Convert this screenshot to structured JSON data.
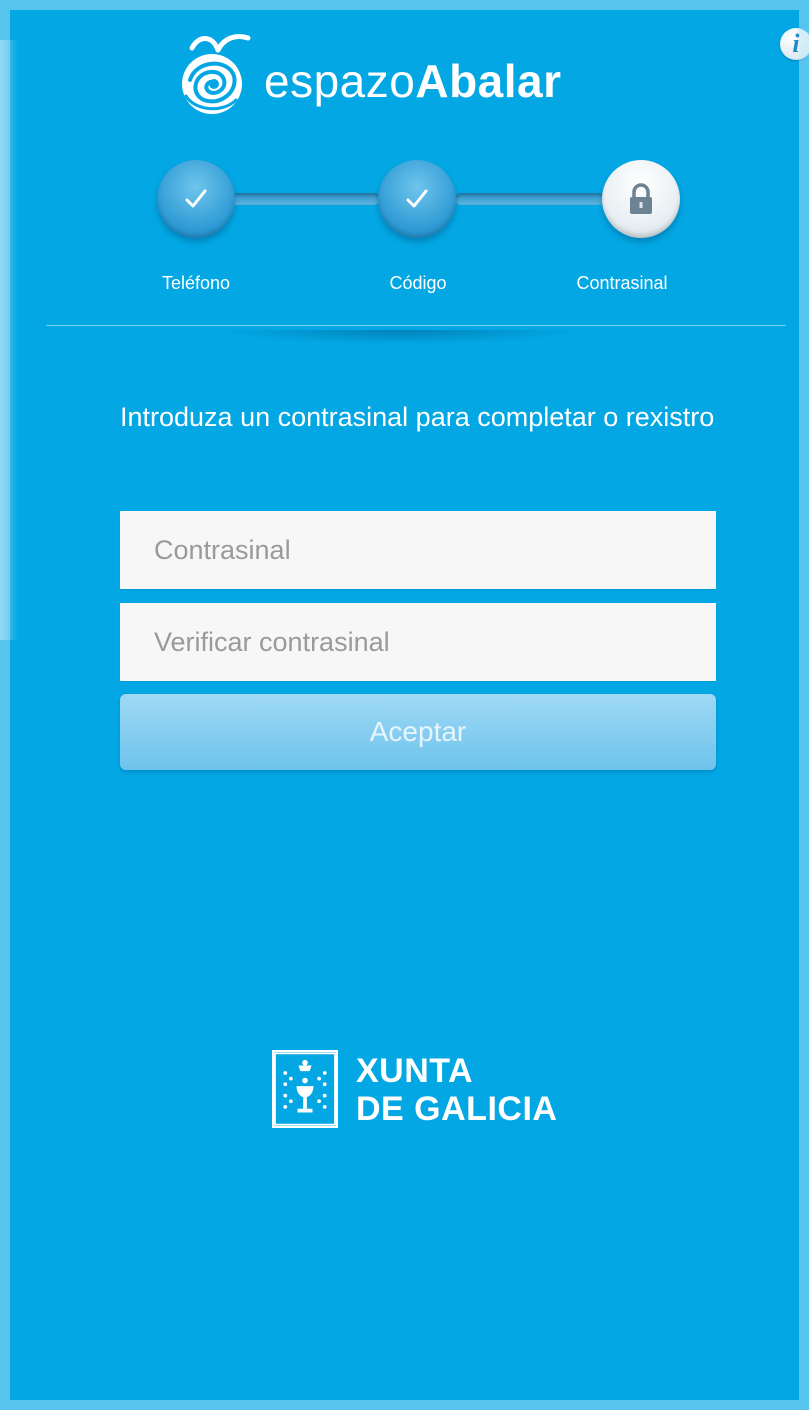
{
  "info": {
    "icon": "info-icon",
    "glyph": "i"
  },
  "logo": {
    "text_light": "espazo",
    "text_bold": "Abalar",
    "icon": "espazo-abalar-logo-icon"
  },
  "steps": [
    {
      "label": "Teléfono",
      "state": "done",
      "icon": "check-icon"
    },
    {
      "label": "Código",
      "state": "done",
      "icon": "check-icon"
    },
    {
      "label": "Contrasinal",
      "state": "active",
      "icon": "lock-icon"
    }
  ],
  "form": {
    "instruction": "Introduza un contrasinal para completar o rexistro",
    "password_placeholder": "Contrasinal",
    "password_value": "",
    "verify_placeholder": "Verificar contrasinal",
    "verify_value": "",
    "accept_label": "Aceptar"
  },
  "footer": {
    "line1": "XUNTA",
    "line2": "DE GALICIA",
    "icon": "galicia-coat-of-arms-icon"
  },
  "colors": {
    "background": "#02a7e3",
    "button_disabled": "#8fd2f3",
    "field": "#f7f7f7"
  }
}
